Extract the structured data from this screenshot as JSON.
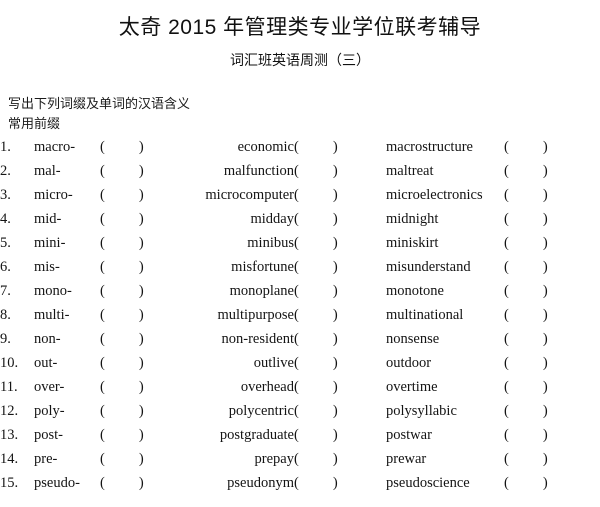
{
  "header": {
    "title": "太奇 2015 年管理类专业学位联考辅导",
    "subtitle": "词汇班英语周测（三）"
  },
  "instructions": {
    "line1": "写出下列词缀及单词的汉语含义",
    "line2": "常用前缀"
  },
  "paren": {
    "open": "(",
    "close": ")"
  },
  "rows": [
    {
      "num": "1.",
      "prefix": "macro-",
      "word1": "economic",
      "word2": "macrostructure"
    },
    {
      "num": "2.",
      "prefix": "mal-",
      "word1": "malfunction",
      "word2": "maltreat"
    },
    {
      "num": "3.",
      "prefix": "micro-",
      "word1": "microcomputer",
      "word2": "microelectronics"
    },
    {
      "num": "4.",
      "prefix": "mid-",
      "word1": "midday",
      "word2": "midnight"
    },
    {
      "num": "5.",
      "prefix": "mini-",
      "word1": "minibus",
      "word2": "miniskirt"
    },
    {
      "num": "6.",
      "prefix": "mis-",
      "word1": "misfortune",
      "word2": "misunderstand"
    },
    {
      "num": "7.",
      "prefix": "mono-",
      "word1": "monoplane",
      "word2": "monotone"
    },
    {
      "num": "8.",
      "prefix": "multi-",
      "word1": "multipurpose",
      "word2": "multinational"
    },
    {
      "num": "9.",
      "prefix": "non-",
      "word1": "non-resident",
      "word2": "nonsense"
    },
    {
      "num": "10.",
      "prefix": "out-",
      "word1": "outlive",
      "word2": "outdoor"
    },
    {
      "num": "11.",
      "prefix": "over-",
      "word1": "overhead",
      "word2": "overtime"
    },
    {
      "num": "12.",
      "prefix": "poly-",
      "word1": "polycentric",
      "word2": "polysyllabic"
    },
    {
      "num": "13.",
      "prefix": "post-",
      "word1": "postgraduate",
      "word2": "postwar"
    },
    {
      "num": "14.",
      "prefix": "pre-",
      "word1": "prepay",
      "word2": "prewar"
    },
    {
      "num": "15.",
      "prefix": "pseudo-",
      "word1": "pseudonym",
      "word2": "pseudoscience"
    }
  ]
}
